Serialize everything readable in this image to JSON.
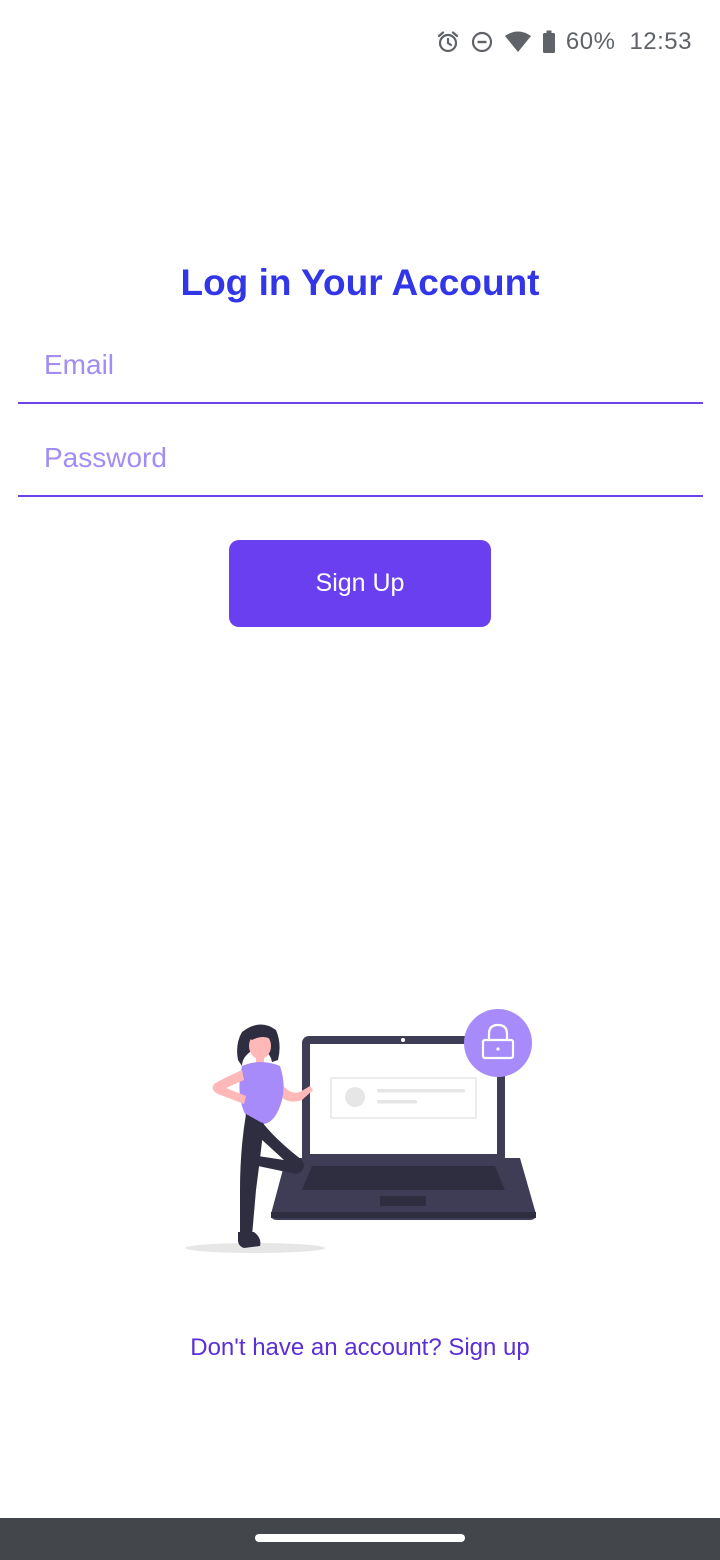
{
  "status_bar": {
    "icons": [
      "alarm-icon",
      "do-not-disturb-icon",
      "wifi-icon",
      "battery-icon"
    ],
    "battery_percent": "60%",
    "time": "12:53"
  },
  "login": {
    "title": "Log in Your Account",
    "email_placeholder": "Email",
    "email_value": "",
    "password_placeholder": "Password",
    "password_value": "",
    "submit_label": "Sign Up"
  },
  "footer": {
    "signup_prompt": "Don't have an account? Sign up"
  },
  "colors": {
    "title": "#3236e6",
    "accent": "#6a3ff0",
    "placeholder": "#a38cf4",
    "link": "#5b2fd8",
    "nav_bar": "#43474c"
  }
}
